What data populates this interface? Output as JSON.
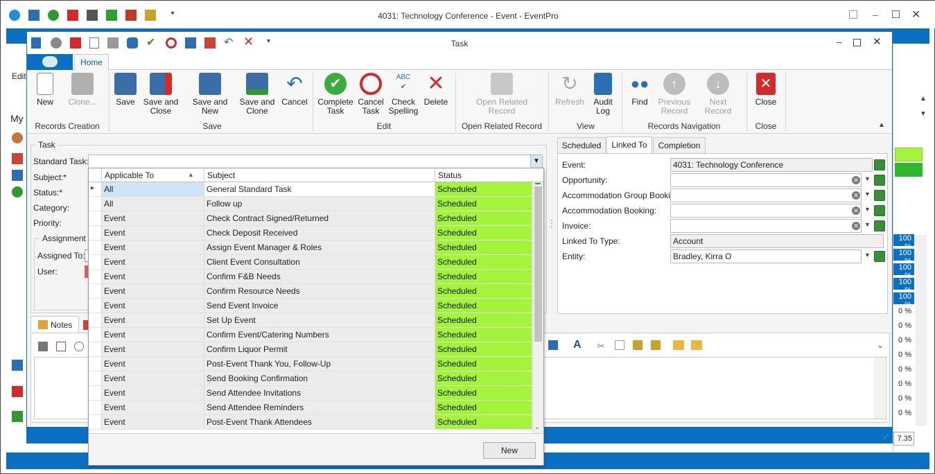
{
  "outer": {
    "title": "4031: Technology Conference - Event - EventPro",
    "left_labels": [
      "Edit",
      "My"
    ],
    "right_zoom": "7.35",
    "percent_column": [
      "100 %",
      "100 %",
      "100 %",
      "100 %",
      "100 %",
      "0 %",
      "0 %",
      "0 %",
      "0 %",
      "0 %",
      "0 %",
      "0 %",
      "0 %"
    ]
  },
  "task": {
    "title": "Task",
    "home_tab": "Home"
  },
  "ribbon": {
    "buttons": {
      "new": "New",
      "clone": "Clone...",
      "save": "Save",
      "save_close": "Save and Close",
      "save_new": "Save and New",
      "save_clone": "Save and Clone",
      "cancel": "Cancel",
      "complete_task": "Complete Task",
      "cancel_task": "Cancel Task",
      "check_spelling": "Check Spelling",
      "delete": "Delete",
      "open_related": "Open Related Record",
      "refresh": "Refresh",
      "audit_log": "Audit Log",
      "find": "Find",
      "prev_record": "Previous Record",
      "next_record": "Next Record",
      "close": "Close"
    },
    "groups": {
      "records_creation": "Records Creation",
      "save": "Save",
      "edit": "Edit",
      "open_related": "Open Related Record",
      "view": "View",
      "records_navigation": "Records Navigation",
      "close": "Close"
    }
  },
  "form": {
    "group_title": "Task",
    "standard_task_label": "Standard Task:",
    "subject_label": "Subject:*",
    "status_label": "Status:*",
    "category_label": "Category:",
    "priority_label": "Priority:",
    "assignment_title": "Assignment",
    "assigned_to_label": "Assigned To:",
    "user_label": "User:",
    "notes_tab": "Notes"
  },
  "dropdown": {
    "columns": {
      "applicable": "Applicable To",
      "subject": "Subject",
      "status": "Status"
    },
    "rows": [
      {
        "applicable": "All",
        "subject": "General Standard Task",
        "status": "Scheduled"
      },
      {
        "applicable": "All",
        "subject": "Follow up",
        "status": "Scheduled"
      },
      {
        "applicable": "Event",
        "subject": "Check Contract Signed/Returned",
        "status": "Scheduled"
      },
      {
        "applicable": "Event",
        "subject": "Check Deposit Received",
        "status": "Scheduled"
      },
      {
        "applicable": "Event",
        "subject": "Assign Event Manager & Roles",
        "status": "Scheduled"
      },
      {
        "applicable": "Event",
        "subject": "Client Event Consultation",
        "status": "Scheduled"
      },
      {
        "applicable": "Event",
        "subject": "Confirm F&B Needs",
        "status": "Scheduled"
      },
      {
        "applicable": "Event",
        "subject": "Confirm Resource Needs",
        "status": "Scheduled"
      },
      {
        "applicable": "Event",
        "subject": "Send Event Invoice",
        "status": "Scheduled"
      },
      {
        "applicable": "Event",
        "subject": "Set Up Event",
        "status": "Scheduled"
      },
      {
        "applicable": "Event",
        "subject": "Confirm Event/Catering Numbers",
        "status": "Scheduled"
      },
      {
        "applicable": "Event",
        "subject": "Confirm Liquor Permit",
        "status": "Scheduled"
      },
      {
        "applicable": "Event",
        "subject": "Post-Event Thank You, Follow-Up",
        "status": "Scheduled"
      },
      {
        "applicable": "Event",
        "subject": "Send Booking Confirmation",
        "status": "Scheduled"
      },
      {
        "applicable": "Event",
        "subject": "Send Attendee Invitations",
        "status": "Scheduled"
      },
      {
        "applicable": "Event",
        "subject": "Send Attendee Reminders",
        "status": "Scheduled"
      },
      {
        "applicable": "Event",
        "subject": "Post-Event Thank Attendees",
        "status": "Scheduled"
      }
    ],
    "new_button": "New"
  },
  "right_panel": {
    "tabs": {
      "scheduled": "Scheduled",
      "linked_to": "Linked To",
      "completion": "Completion"
    },
    "fields": {
      "event_label": "Event:",
      "event_value": "4031: Technology Conference",
      "opportunity_label": "Opportunity:",
      "acc_group_label": "Accommodation Group Booking:",
      "acc_booking_label": "Accommodation Booking:",
      "invoice_label": "Invoice:",
      "linked_type_label": "Linked To Type:",
      "linked_type_value": "Account",
      "entity_label": "Entity:",
      "entity_value": "Bradley, Kirra O"
    }
  },
  "colors": {
    "accent_blue": "#0b6fc2",
    "status_green": "#a4f43c",
    "selected_row": "#cfe4f7"
  }
}
